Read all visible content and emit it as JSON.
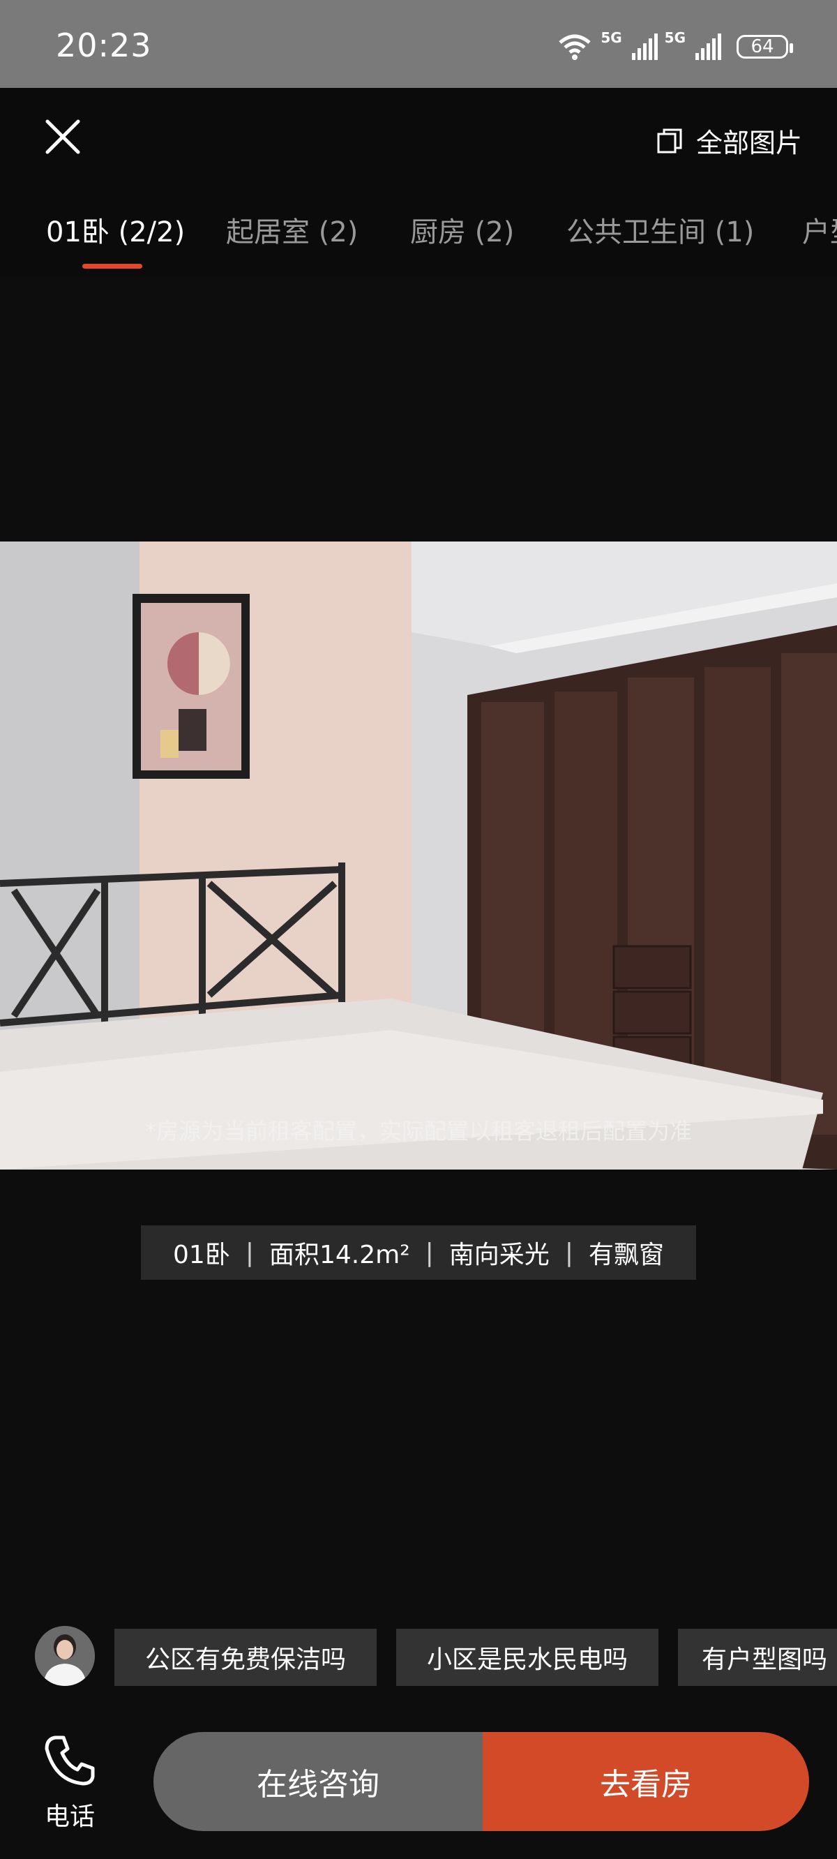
{
  "status_bar": {
    "time": "20:23",
    "network_1": "5G",
    "network_2": "5G",
    "battery": "64"
  },
  "header": {
    "all_photos_label": "全部图片"
  },
  "tabs": [
    {
      "label": "01卧 (2/2)"
    },
    {
      "label": "起居室 (2)"
    },
    {
      "label": "厨房 (2)"
    },
    {
      "label": "公共卫生间 (1)"
    },
    {
      "label": "户型"
    }
  ],
  "photo": {
    "disclaimer": "*房源为当前租客配置，实际配置以租客退租后配置为准"
  },
  "room_info": {
    "room": "01卧",
    "area": "面积14.2m²",
    "orientation": "南向采光",
    "feature": "有飘窗"
  },
  "quick_questions": [
    "公区有免费保洁吗",
    "小区是民水民电吗",
    "有户型图吗"
  ],
  "bottom": {
    "phone_label": "电话",
    "consult_label": "在线咨询",
    "view_label": "去看房"
  },
  "colors": {
    "accent": "#d34a28",
    "tab_underline": "#e2492a"
  }
}
